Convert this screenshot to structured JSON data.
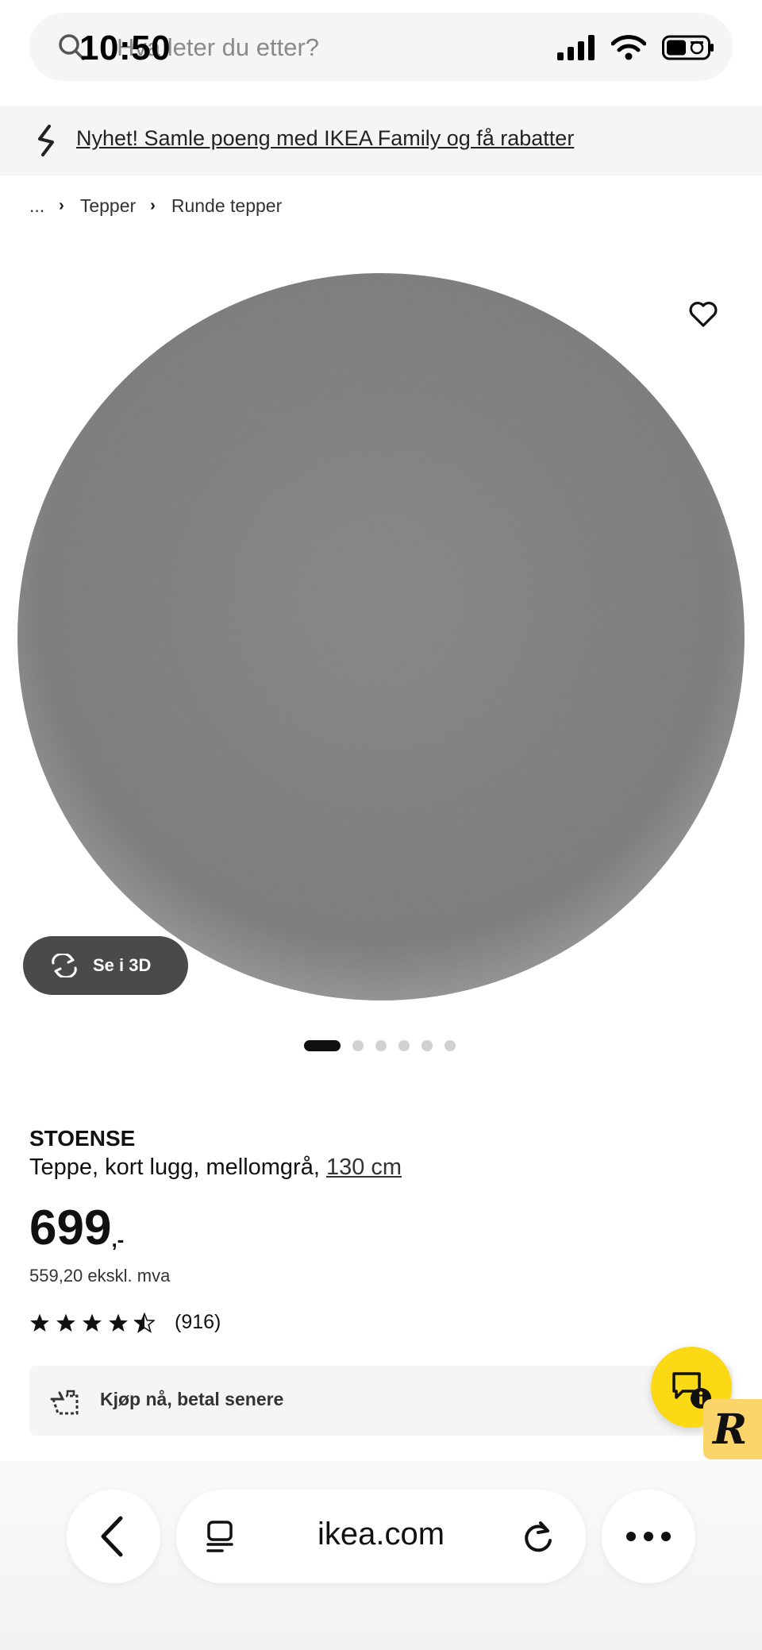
{
  "status_bar": {
    "time": "10:50"
  },
  "search": {
    "placeholder": "Hva leter du etter?"
  },
  "promo": {
    "text": "Nyhet! Samle poeng med IKEA Family og få rabatter"
  },
  "breadcrumb": {
    "ellipsis": "...",
    "items": [
      "Tepper",
      "Runde tepper"
    ]
  },
  "gallery": {
    "see_3d_label": "Se i 3D",
    "dot_count": 6,
    "active_index": 0
  },
  "product": {
    "name": "STOENSE",
    "description": "Teppe, kort lugg, mellomgrå,",
    "size": "130 cm",
    "price_integer": "699",
    "price_suffix": ",-",
    "price_ex_vat": "559,20 ekskl. mva",
    "rating_stars": 4.5,
    "rating_max": 5,
    "review_count": "(916)"
  },
  "bnpl": {
    "label": "Kjøp nå, betal senere"
  },
  "browser": {
    "url": "ikea.com"
  },
  "colors": {
    "chat_button": "#fbd914",
    "r_badge": "#fbd46a",
    "see3d_bg": "#4a4a4a",
    "rug": "#858585"
  }
}
